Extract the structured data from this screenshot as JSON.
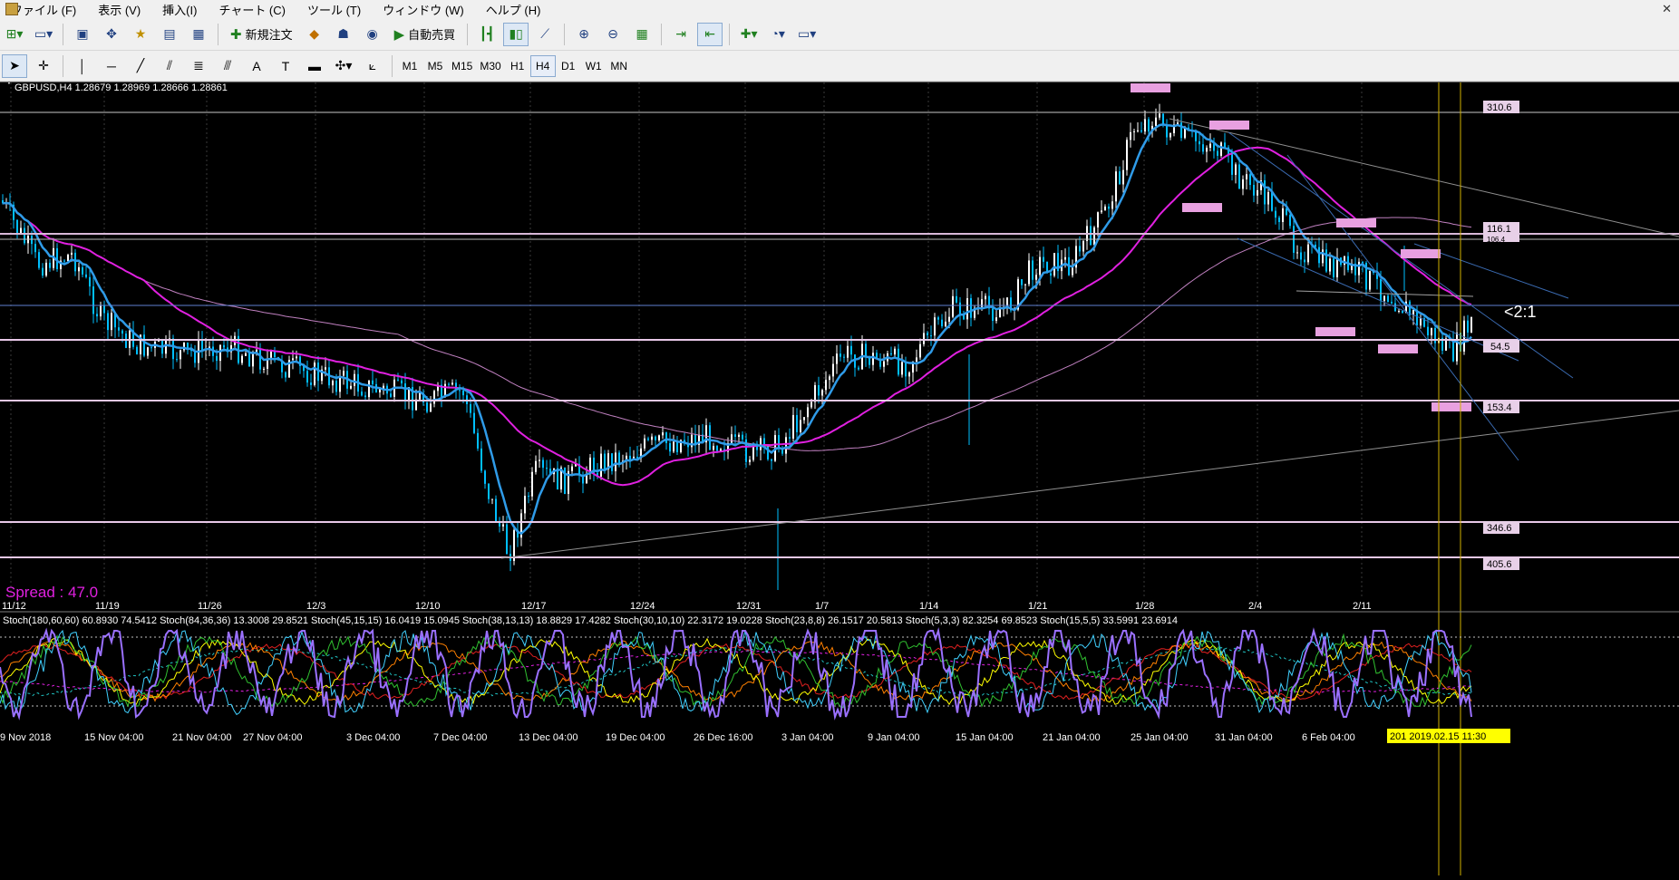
{
  "menu": {
    "items": [
      "ファイル (F)",
      "表示 (V)",
      "挿入(I)",
      "チャート (C)",
      "ツール (T)",
      "ウィンドウ (W)",
      "ヘルプ (H)"
    ]
  },
  "toolbar": {
    "new_order_label": "新規注文",
    "auto_trade_label": "自動売買",
    "timeframes": [
      "M1",
      "M5",
      "M15",
      "M30",
      "H1",
      "H4",
      "D1",
      "W1",
      "MN"
    ],
    "active_timeframe": "H4"
  },
  "chart": {
    "title": "GBPUSD,H4  1.28679 1.28969 1.28666 1.28861",
    "spread_label": "Spread : 47.0",
    "ratio_label": "<2:1",
    "colors": {
      "price_up": "#ffffff",
      "price_down": "#00bfff",
      "ma_fast": "#2f9be8",
      "ma_mid": "#e020e0",
      "ma_slow": "#c080c0",
      "stoch_main": "#9a70ff",
      "vertical_line": "#d0b000",
      "rect": "#e8a0e0",
      "spread": "#e020e0"
    },
    "price_tags": [
      "310.6",
      "116.1",
      "54.5",
      "153.4",
      "346.6",
      "405.6"
    ],
    "hidden_tag": "106.4",
    "top_axis_labels": [
      "11/12",
      "11/19",
      "11/26",
      "12/3",
      "12/10",
      "12/17",
      "12/24",
      "12/31",
      "1/7",
      "1/14",
      "1/21",
      "1/28",
      "2/4",
      "2/11"
    ],
    "bottom_axis_labels": [
      "9 Nov 2018",
      "15 Nov 04:00",
      "21 Nov 04:00",
      "27 Nov 04:00",
      "3 Dec 04:00",
      "7 Dec 04:00",
      "13 Dec 04:00",
      "19 Dec 04:00",
      "26 Dec 16:00",
      "3 Jan 04:00",
      "9 Jan 04:00",
      "15 Jan 04:00",
      "21 Jan 04:00",
      "25 Jan 04:00",
      "31 Jan 04:00",
      "6 Feb 04:00"
    ],
    "cursor_time_label": "201 2019.02.15 11:30",
    "indicator_label": "Stoch(180,60,60) 60.8930 74.5412  Stoch(84,36,36) 13.3008 29.8521  Stoch(45,15,15) 16.0419 15.0945  Stoch(38,13,13) 18.8829 17.4282  Stoch(30,10,10) 22.3172 19.0228  Stoch(23,8,8) 26.1517 20.5813  Stoch(5,3,3) 82.3254 69.8523  Stoch(15,5,5) 33.5991 23.6914"
  }
}
